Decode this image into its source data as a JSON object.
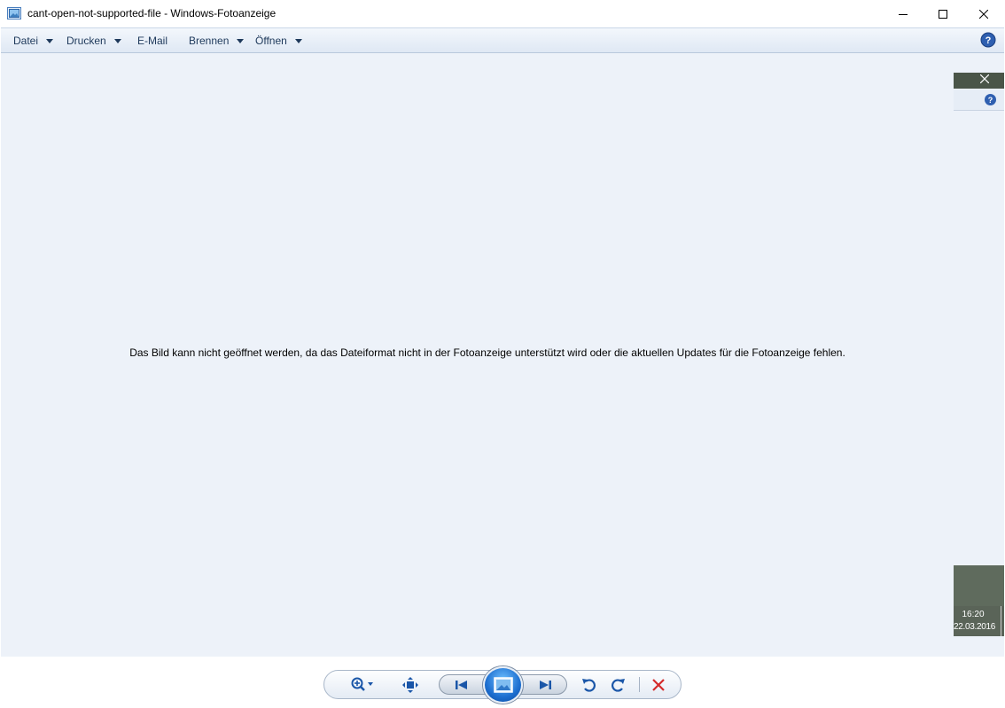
{
  "window": {
    "title": "cant-open-not-supported-file - Windows-Fotoanzeige",
    "icons": {
      "app": "photo-viewer-app-icon",
      "minimize": "minimize-icon",
      "maximize": "maximize-icon",
      "close": "close-icon"
    }
  },
  "menu": {
    "items": [
      {
        "label": "Datei",
        "has_dropdown": true
      },
      {
        "label": "Drucken",
        "has_dropdown": true
      },
      {
        "label": "E-Mail",
        "has_dropdown": false
      },
      {
        "label": "Brennen",
        "has_dropdown": true
      },
      {
        "label": "Öffnen",
        "has_dropdown": true
      }
    ],
    "help_icon": "help-icon"
  },
  "viewer": {
    "message": "Das Bild kann nicht geöffnet werden, da das Dateiformat nicht in der Fotoanzeige unterstützt wird oder die aktuellen Updates für die Fotoanzeige fehlen."
  },
  "overlay_fragment": {
    "time": "16:20",
    "date": "22.03.2016"
  },
  "controls": {
    "items": [
      {
        "name": "zoom-button",
        "icon": "zoom-icon"
      },
      {
        "name": "fit-to-window-button",
        "icon": "fit-icon"
      },
      {
        "name": "previous-button",
        "icon": "previous-icon"
      },
      {
        "name": "slideshow-button",
        "icon": "slideshow-icon"
      },
      {
        "name": "next-button",
        "icon": "next-icon"
      },
      {
        "name": "rotate-left-button",
        "icon": "rotate-counterclockwise-icon"
      },
      {
        "name": "rotate-right-button",
        "icon": "rotate-clockwise-icon"
      },
      {
        "name": "delete-button",
        "icon": "delete-icon"
      }
    ]
  },
  "colors": {
    "menubar": "#dfe8f4",
    "viewer_background": "#edf2f9",
    "accent_blue": "#1d6fd0",
    "delete_red": "#d42a2a",
    "control_icon_blue": "#1a56a8"
  }
}
